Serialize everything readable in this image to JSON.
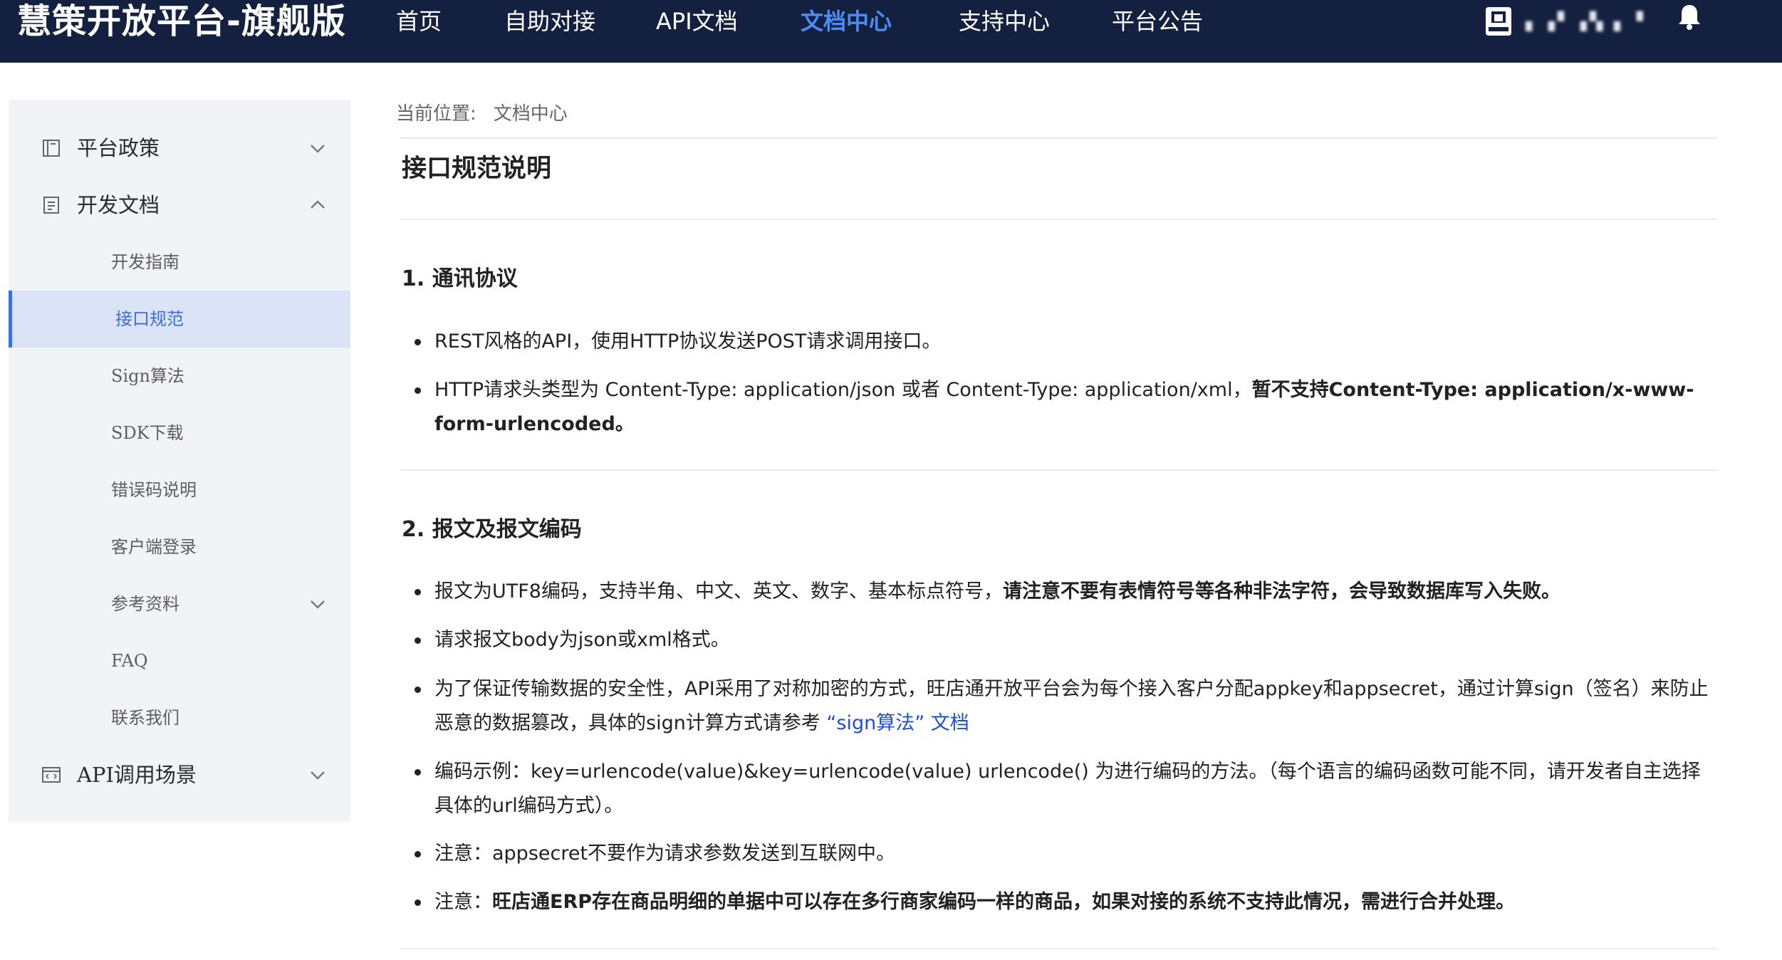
{
  "header": {
    "brand": "慧策开放平台-旗舰版",
    "nav": [
      {
        "label": "首页"
      },
      {
        "label": "自助对接"
      },
      {
        "label": "API文档"
      },
      {
        "label": "文档中心"
      },
      {
        "label": "支持中心"
      },
      {
        "label": "平台公告"
      }
    ],
    "active_nav": "文档中心",
    "user_name": "▖▗▘▗▚ ▖▝",
    "avatar_icon": "user-avatar-icon",
    "bell_icon": "bell-icon"
  },
  "sidebar": {
    "groups": [
      {
        "label": "平台政策",
        "icon": "book-icon",
        "expanded": false
      },
      {
        "label": "开发文档",
        "icon": "document-icon",
        "expanded": true
      },
      {
        "label": "API调用场景",
        "icon": "code-window-icon",
        "expanded": false
      }
    ],
    "sub_items": [
      {
        "label": "开发指南"
      },
      {
        "label": "接口规范"
      },
      {
        "label": "Sign算法"
      },
      {
        "label": "SDK下载"
      },
      {
        "label": "错误码说明"
      },
      {
        "label": "客户端登录"
      },
      {
        "label": "参考资料"
      },
      {
        "label": "FAQ"
      },
      {
        "label": "联系我们"
      }
    ],
    "active_item": "接口规范"
  },
  "content": {
    "breadcrumb_label": "当前位置:",
    "breadcrumb_value": "文档中心",
    "title": "接口规范说明",
    "section1": {
      "title": "1. 通讯协议",
      "b1": "REST风格的API，使用HTTP协议发送POST请求调用接口。",
      "b2_plain": "HTTP请求头类型为 Content-Type: application/json 或者 Content-Type: application/xml，",
      "b2_bold": "暂不支持Content-Type: application/x-www-form-urlencoded。"
    },
    "section2": {
      "title": "2. 报文及报文编码",
      "b1_plain": "报文为UTF8编码，支持半角、中文、英文、数字、基本标点符号，",
      "b1_bold": "请注意不要有表情符号等各种非法字符，会导致数据库写入失败。",
      "b2": "请求报文body为json或xml格式。",
      "b3_plain": "为了保证传输数据的安全性，API采用了对称加密的方式，旺店通开放平台会为每个接入客户分配appkey和appsecret，通过计算sign（签名）来防止恶意的数据篡改，具体的sign计算方式请参考 ",
      "b3_link": "“sign算法” 文档",
      "b4": "编码示例：key=urlencode(value)&key=urlencode(value) urlencode() 为进行编码的方法。（每个语言的编码函数可能不同，请开发者自主选择具体的url编码方式）。",
      "b5": "注意：appsecret不要作为请求参数发送到互联网中。",
      "b6_plain": "注意：",
      "b6_bold": "旺店通ERP存在商品明细的单据中可以存在多行商家编码一样的商品，如果对接的系统不支持此情况，需进行合并处理。"
    }
  },
  "colors": {
    "header_bg": "#14203f",
    "nav_active": "#4c8cf5",
    "sidebar_bg": "#f2f3f6",
    "active_item_bg": "#dbe3f6",
    "active_item_text": "#3b6fe0",
    "link": "#1f4fd0"
  }
}
